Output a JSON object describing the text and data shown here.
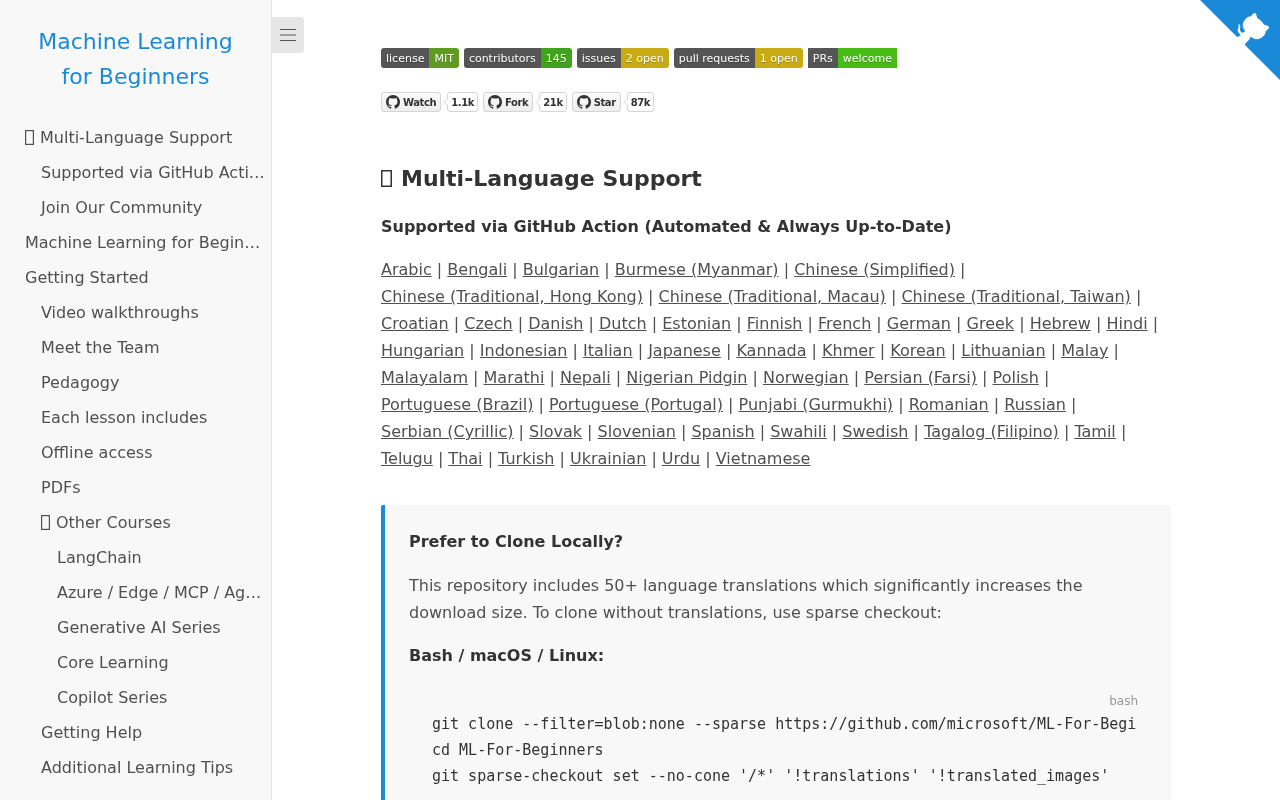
{
  "sidebar": {
    "title": "Machine Learning for Beginners",
    "items": [
      {
        "label": "Multi-Language Support",
        "has_icon": true,
        "children": [
          {
            "label": "Supported via GitHub Acti…"
          },
          {
            "label": "Join Our Community"
          }
        ]
      },
      {
        "label": "Machine Learning for Begin…"
      },
      {
        "label": "Getting Started",
        "children": [
          {
            "label": "Video walkthroughs"
          },
          {
            "label": "Meet the Team"
          },
          {
            "label": "Pedagogy"
          },
          {
            "label": "Each lesson includes"
          },
          {
            "label": "Offline access"
          },
          {
            "label": "PDFs"
          },
          {
            "label": "Other Courses",
            "has_icon": true,
            "children": [
              {
                "label": "LangChain"
              },
              {
                "label": "Azure / Edge / MCP / Ag…"
              },
              {
                "label": "Generative AI Series"
              },
              {
                "label": "Core Learning"
              },
              {
                "label": "Copilot Series"
              }
            ]
          },
          {
            "label": "Getting Help"
          },
          {
            "label": "Additional Learning Tips"
          }
        ]
      }
    ]
  },
  "badges": [
    {
      "label": "license",
      "value": "MIT",
      "color": "#5f9b21"
    },
    {
      "label": "contributors",
      "value": "145",
      "color": "#40a31c"
    },
    {
      "label": "issues",
      "value": "2 open",
      "color": "#c8aa12"
    },
    {
      "label": "pull requests",
      "value": "1 open",
      "color": "#c8aa12"
    },
    {
      "label": "PRs",
      "value": "welcome",
      "color": "#46bc14",
      "square": true
    }
  ],
  "repo_buttons": [
    {
      "label": "Watch",
      "count": "1.1k"
    },
    {
      "label": "Fork",
      "count": "21k"
    },
    {
      "label": "Star",
      "count": "87k"
    }
  ],
  "heading": {
    "text": "Multi-Language Support",
    "has_icon": true
  },
  "subheading": "Supported via GitHub Action (Automated & Always Up-to-Date)",
  "languages": [
    {
      "label": "Arabic",
      "separator": "|"
    },
    {
      "label": "Bengali",
      "separator": "|"
    },
    {
      "label": "Bulgarian",
      "separator": "|"
    },
    {
      "label": "Burmese (Myanmar)",
      "separator": "|"
    },
    {
      "label": "Chinese (Simplified)",
      "separator": "|"
    },
    {
      "label": "Chinese (Traditional, Hong Kong)",
      "separator": "|"
    },
    {
      "label": "Chinese (Traditional, Macau)",
      "separator": "|"
    },
    {
      "label": "Chinese (Traditional, Taiwan)",
      "separator": "|"
    },
    {
      "label": "Croatian",
      "separator": "|"
    },
    {
      "label": "Czech",
      "separator": "|"
    },
    {
      "label": "Danish",
      "separator": "|"
    },
    {
      "label": "Dutch",
      "separator": "|"
    },
    {
      "label": "Estonian",
      "separator": "|"
    },
    {
      "label": "Finnish",
      "separator": "|"
    },
    {
      "label": "French",
      "separator": "|"
    },
    {
      "label": "German",
      "separator": "|"
    },
    {
      "label": "Greek",
      "separator": "|"
    },
    {
      "label": "Hebrew",
      "separator": "|"
    },
    {
      "label": "Hindi",
      "separator": "|"
    },
    {
      "label": "Hungarian",
      "separator": "|"
    },
    {
      "label": "Indonesian",
      "separator": "|"
    },
    {
      "label": "Italian",
      "separator": "|"
    },
    {
      "label": "Japanese",
      "separator": "|"
    },
    {
      "label": "Kannada",
      "separator": "|"
    },
    {
      "label": "Khmer",
      "separator": "|"
    },
    {
      "label": "Korean",
      "separator": "|"
    },
    {
      "label": "Lithuanian",
      "separator": "|"
    },
    {
      "label": "Malay",
      "separator": "|"
    },
    {
      "label": "Malayalam",
      "separator": "|"
    },
    {
      "label": "Marathi",
      "separator": "|"
    },
    {
      "label": "Nepali",
      "separator": "|"
    },
    {
      "label": "Nigerian Pidgin",
      "separator": "|"
    },
    {
      "label": "Norwegian",
      "separator": "|"
    },
    {
      "label": "Persian (Farsi)",
      "separator": "|"
    },
    {
      "label": "Polish",
      "separator": "|"
    },
    {
      "label": "Portuguese (Brazil)",
      "separator": "|"
    },
    {
      "label": "Portuguese (Portugal)",
      "separator": "|"
    },
    {
      "label": "Punjabi (Gurmukhi)",
      "separator": "|"
    },
    {
      "label": "Romanian",
      "separator": "|"
    },
    {
      "label": "Russian",
      "separator": "|"
    },
    {
      "label": "Serbian (Cyrillic)",
      "separator": "|"
    },
    {
      "label": "Slovak",
      "separator": "|"
    },
    {
      "label": "Slovenian",
      "separator": "|"
    },
    {
      "label": "Spanish",
      "separator": "|"
    },
    {
      "label": "Swahili",
      "separator": "|"
    },
    {
      "label": "Swedish",
      "separator": "|"
    },
    {
      "label": "Tagalog (Filipino)",
      "separator": "|"
    },
    {
      "label": "Tamil",
      "separator": "|"
    },
    {
      "label": "Telugu",
      "separator": "|"
    },
    {
      "label": "Thai",
      "separator": "|"
    },
    {
      "label": "Turkish",
      "separator": "|"
    },
    {
      "label": "Ukrainian",
      "separator": "|"
    },
    {
      "label": "Urdu",
      "separator": "|"
    },
    {
      "label": "Vietnamese"
    }
  ],
  "callout": {
    "title": "Prefer to Clone Locally?",
    "text": "This repository includes 50+ language translations which significantly increases the download size. To clone without translations, use sparse checkout:",
    "code_heading": "Bash / macOS / Linux:",
    "code": {
      "language": "bash",
      "lines": [
        "git clone --filter=blob:none --sparse https://github.com/microsoft/ML-For-Begi",
        "cd ML-For-Beginners",
        "git sparse-checkout set --no-cone '/*' '!translations' '!translated_images'"
      ]
    }
  }
}
